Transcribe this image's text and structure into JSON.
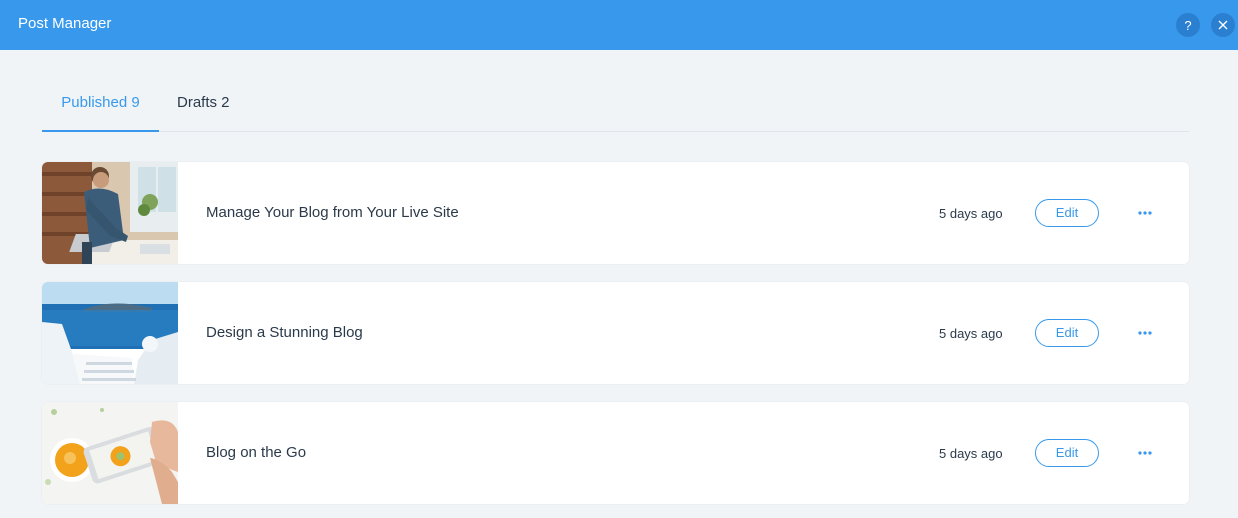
{
  "header": {
    "title": "Post Manager",
    "help_icon": "question-icon",
    "close_icon": "close-icon"
  },
  "tabs": [
    {
      "label": "Published 9",
      "active": true
    },
    {
      "label": "Drafts 2",
      "active": false
    }
  ],
  "posts": [
    {
      "title": "Manage Your Blog from Your Live Site",
      "time": "5 days ago",
      "edit_label": "Edit",
      "more_icon": "more-options-icon",
      "thumbnail": "man-with-laptop-image"
    },
    {
      "title": "Design a Stunning Blog",
      "time": "5 days ago",
      "edit_label": "Edit",
      "more_icon": "more-options-icon",
      "thumbnail": "santorini-sea-image"
    },
    {
      "title": "Blog on the Go",
      "time": "5 days ago",
      "edit_label": "Edit",
      "more_icon": "more-options-icon",
      "thumbnail": "phone-food-photo-image"
    }
  ],
  "colors": {
    "accent": "#3899ec",
    "background": "#f0f4f7",
    "text": "#2b3a4a"
  }
}
